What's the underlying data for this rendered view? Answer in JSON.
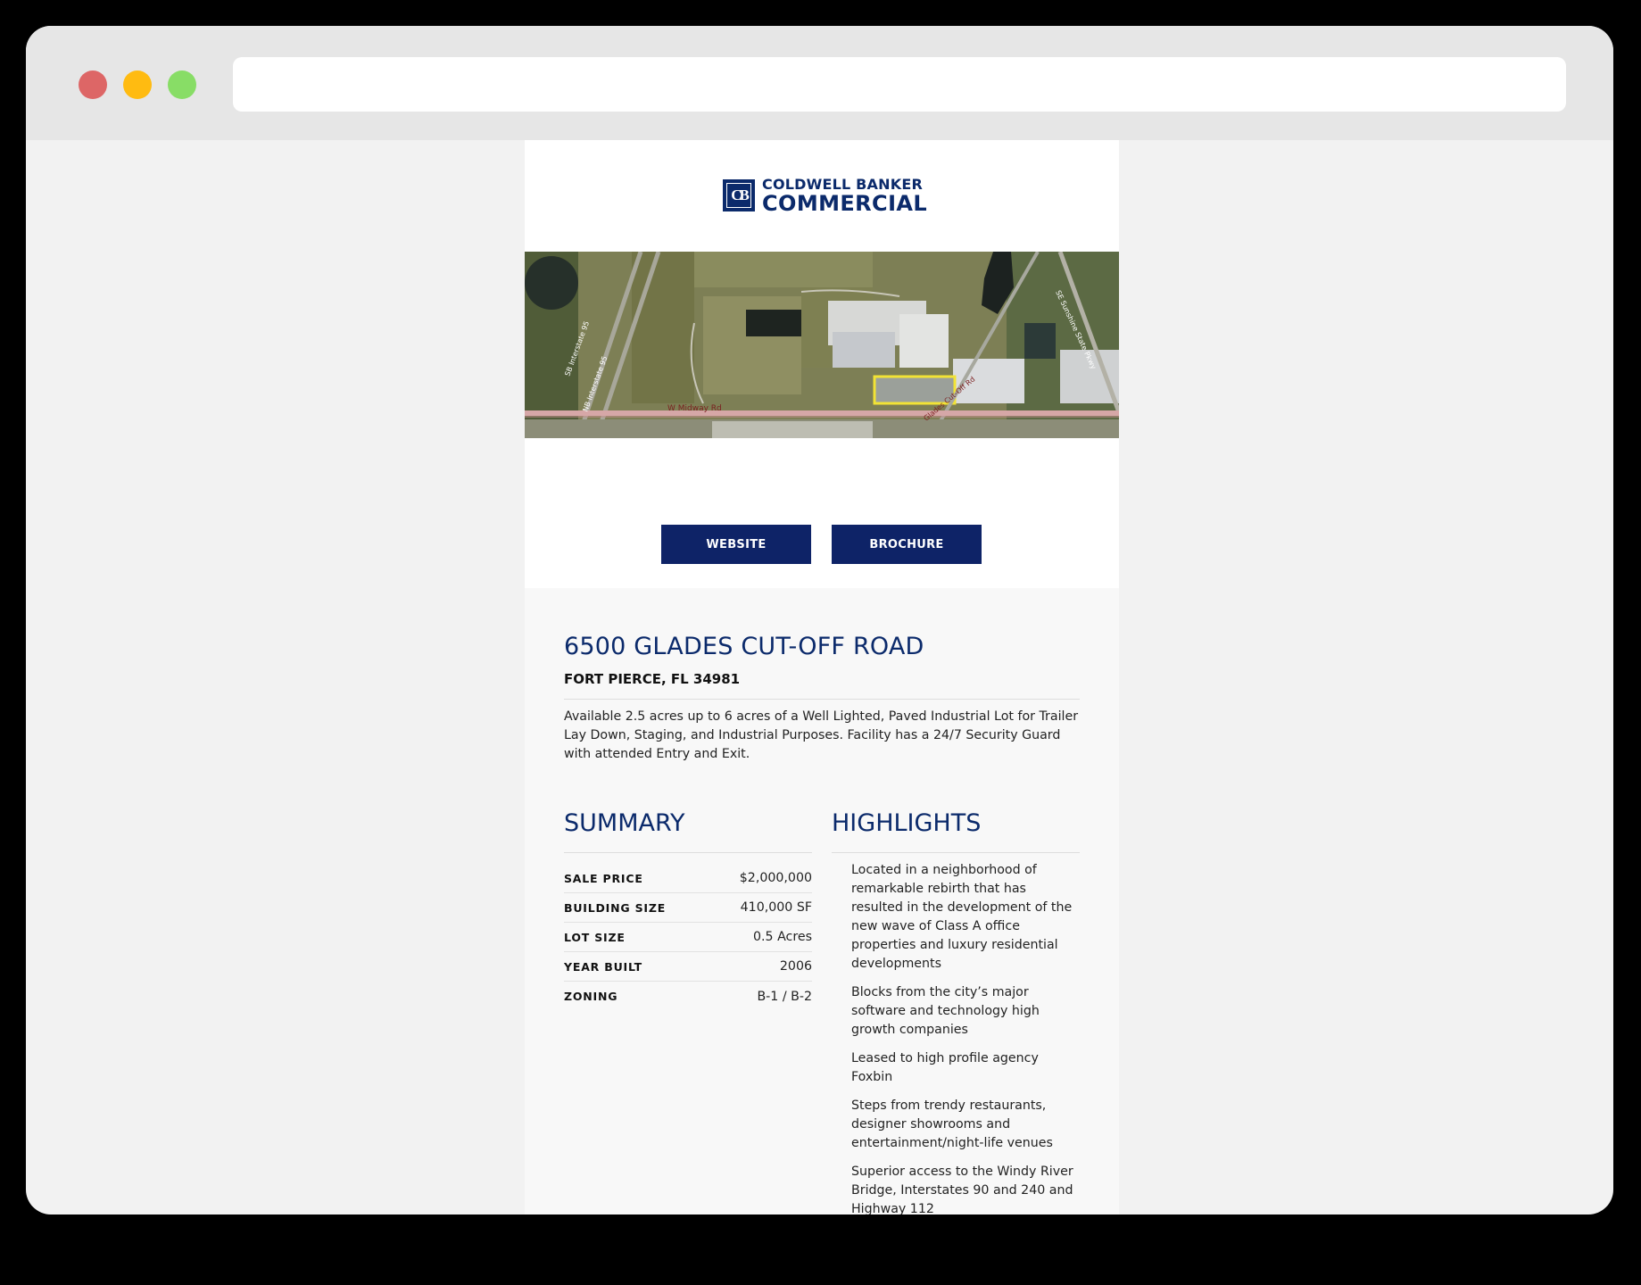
{
  "browser": {
    "url": ""
  },
  "logo": {
    "mark": "CB",
    "line1": "COLDWELL BANKER",
    "line2": "COMMERCIAL"
  },
  "map": {
    "road_labels": [
      "W Midway Rd",
      "Glades Cut-Off Rd",
      "SB Interstate 95",
      "NB Interstate 95",
      "SE Sunshine State Pkwy"
    ]
  },
  "buttons": {
    "website": "WEBSITE",
    "brochure": "BROCHURE"
  },
  "property": {
    "address": "6500 GLADES CUT-OFF ROAD",
    "city": "FORT PIERCE, FL 34981",
    "description": "Available 2.5 acres up to 6 acres of a Well Lighted, Paved Industrial Lot for Trailer Lay Down, Staging, and Industrial Purposes. Facility has a 24/7 Security Guard with attended Entry and Exit."
  },
  "summary": {
    "title": "SUMMARY",
    "rows": [
      {
        "label": "SALE PRICE",
        "value": "$2,000,000"
      },
      {
        "label": "BUILDING SIZE",
        "value": "410,000 SF"
      },
      {
        "label": "LOT SIZE",
        "value": "0.5 Acres"
      },
      {
        "label": "YEAR BUILT",
        "value": "2006"
      },
      {
        "label": "ZONING",
        "value": "B-1 / B-2"
      }
    ]
  },
  "highlights": {
    "title": "HIGHLIGHTS",
    "items": [
      "Located in a neighborhood of remarkable rebirth that has resulted in the development of the new wave of Class A office properties and luxury residential developments",
      "Blocks from the city’s major software and technology high growth companies",
      "Leased to high profile agency Foxbin",
      "Steps from trendy restaurants, designer showrooms and entertainment/night-life venues",
      "Superior access to the Windy River Bridge, Interstates 90 and 240 and Highway 112"
    ]
  }
}
